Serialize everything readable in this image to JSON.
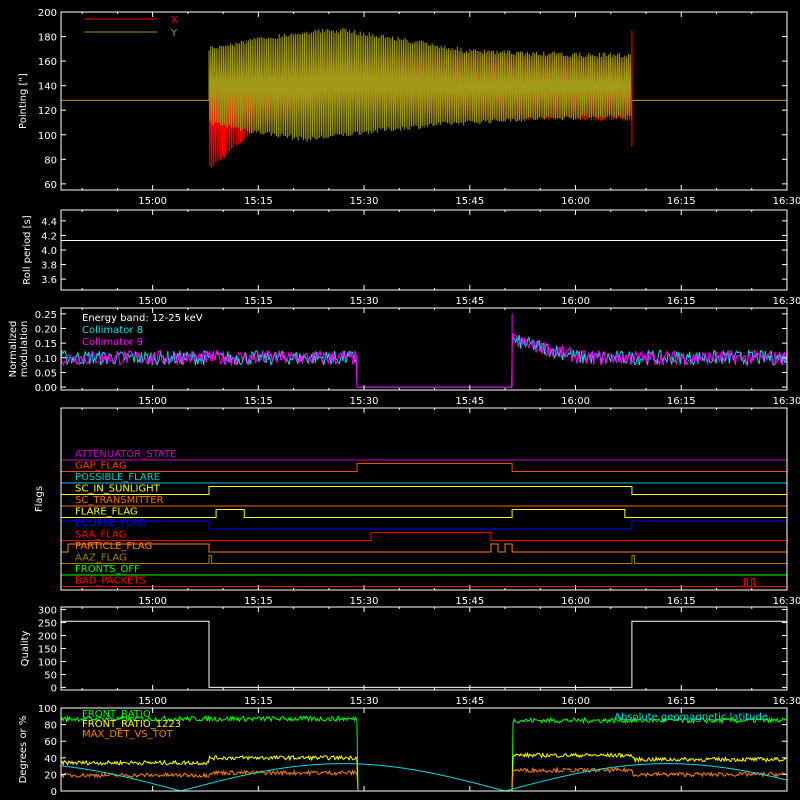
{
  "chart_data": [
    {
      "type": "line",
      "id": "pointing",
      "ylabel": "Pointing [\"]",
      "ylim": [
        55,
        200
      ],
      "yticks": [
        60,
        80,
        100,
        120,
        140,
        160,
        180,
        200
      ],
      "xlim": [
        "14:47",
        "16:30"
      ],
      "xticks": [
        "15:00",
        "15:15",
        "15:30",
        "15:45",
        "16:00",
        "16:15",
        "16:30"
      ],
      "legend": "top-left",
      "series": [
        {
          "name": "X",
          "color": "#ff0000",
          "baseline": 128,
          "active": [
            "15:08",
            "16:08"
          ],
          "upper_env": [
            [
              "15:08",
              165
            ],
            [
              "15:10",
              150
            ],
            [
              "15:20",
              162
            ],
            [
              "15:30",
              166
            ],
            [
              "15:40",
              168
            ],
            [
              "15:50",
              167
            ],
            [
              "16:00",
              164
            ],
            [
              "16:08",
              162
            ]
          ],
          "lower_env": [
            [
              "15:08",
              70
            ],
            [
              "15:10",
              80
            ],
            [
              "15:15",
              105
            ],
            [
              "15:25",
              122
            ],
            [
              "15:35",
              116
            ],
            [
              "15:45",
              112
            ],
            [
              "16:00",
              112
            ],
            [
              "16:08",
              110
            ]
          ]
        },
        {
          "name": "Y",
          "color": "#a09a18",
          "baseline": 128,
          "active": [
            "15:08",
            "16:08"
          ],
          "upper_env": [
            [
              "15:08",
              172
            ],
            [
              "15:15",
              180
            ],
            [
              "15:22",
              186
            ],
            [
              "15:27",
              187
            ],
            [
              "15:35",
              180
            ],
            [
              "15:45",
              170
            ],
            [
              "16:00",
              167
            ],
            [
              "16:08",
              167
            ]
          ],
          "lower_env": [
            [
              "15:08",
              108
            ],
            [
              "15:15",
              100
            ],
            [
              "15:22",
              94
            ],
            [
              "15:30",
              100
            ],
            [
              "15:40",
              106
            ],
            [
              "15:50",
              110
            ],
            [
              "16:00",
              112
            ],
            [
              "16:08",
              113
            ]
          ]
        }
      ]
    },
    {
      "type": "line",
      "id": "roll",
      "ylabel": "Roll period [s]",
      "ylim": [
        3.45,
        4.55
      ],
      "yticks": [
        3.6,
        3.8,
        4.0,
        4.2,
        4.4
      ],
      "xticks": [
        "15:00",
        "15:15",
        "15:30",
        "15:45",
        "16:00",
        "16:15",
        "16:30"
      ],
      "series": [
        {
          "name": "",
          "color": "#ffffff",
          "points": [
            [
              "14:47",
              4.13
            ],
            [
              "16:30",
              4.13
            ]
          ]
        }
      ]
    },
    {
      "type": "line",
      "id": "modulation",
      "ylabel": "Normalized modulation",
      "ylim": [
        -0.01,
        0.27
      ],
      "yticks": [
        0.0,
        0.05,
        0.1,
        0.15,
        0.2,
        0.25
      ],
      "ytick_labels": [
        "0.00",
        "0.05",
        "0.10",
        "0.15",
        "0.20",
        "0.25"
      ],
      "xticks": [
        "15:00",
        "15:15",
        "15:30",
        "15:45",
        "16:00",
        "16:15",
        "16:30"
      ],
      "annotation": "Energy band: 12-25 keV",
      "series": [
        {
          "name": "Collimator 8",
          "color": "#00e0e0"
        },
        {
          "name": "Collimator 9",
          "color": "#ff00ff"
        }
      ],
      "segments": [
        {
          "from": "14:47",
          "to": "15:29",
          "level": 0.1
        },
        {
          "from": "15:29",
          "to": "15:51",
          "level": 0.0
        },
        {
          "from": "15:51",
          "to": "16:30",
          "level": 0.12
        }
      ]
    },
    {
      "type": "table",
      "id": "flags",
      "ylabel": "Flags",
      "xticks": [
        "15:00",
        "15:15",
        "15:30",
        "15:45",
        "16:00",
        "16:15",
        "16:30"
      ],
      "rows": [
        {
          "name": "ATTENUATOR_STATE",
          "color": "#cc00cc",
          "on": []
        },
        {
          "name": "GAP_FLAG",
          "color": "#ff4400",
          "on": [
            [
              "15:29",
              "15:51"
            ]
          ]
        },
        {
          "name": "POSSIBLE_FLARE",
          "color": "#00c8c8",
          "on": []
        },
        {
          "name": "SC_IN_SUNLIGHT",
          "color": "#ffff00",
          "on": [
            [
              "15:08",
              "16:08"
            ]
          ]
        },
        {
          "name": "SC_TRANSMITTER",
          "color": "#ff6a00",
          "on": []
        },
        {
          "name": "FLARE_FLAG",
          "color": "#ffff00",
          "on": [
            [
              "15:09",
              "15:13"
            ],
            [
              "15:51",
              "16:07"
            ]
          ]
        },
        {
          "name": "ECLIPSE_FLAG",
          "color": "#0000ff",
          "on": [
            [
              "14:47",
              "15:08"
            ],
            [
              "16:08",
              "16:30"
            ]
          ]
        },
        {
          "name": "SAA_FLAG",
          "color": "#ff0000",
          "on": [
            [
              "15:31",
              "15:48"
            ]
          ]
        },
        {
          "name": "PARTICLE_FLAG",
          "color": "#ff8000",
          "on": [
            [
              "14:48",
              "15:08"
            ],
            [
              "15:48",
              "15:49"
            ],
            [
              "15:50",
              "15:51"
            ]
          ]
        },
        {
          "name": "AAZ_FLAG",
          "color": "#a08000",
          "on": [
            [
              "15:08",
              "15:08"
            ],
            [
              "16:08",
              "16:08"
            ]
          ]
        },
        {
          "name": "FRONTS_OFF",
          "color": "#00ff00",
          "on": []
        },
        {
          "name": "BAD_PACKETS",
          "color": "#ff0000",
          "on": [
            [
              "16:24",
              "16:24"
            ],
            [
              "16:25",
              "16:25"
            ]
          ]
        }
      ]
    },
    {
      "type": "line",
      "id": "quality",
      "ylabel": "Quality",
      "ylim": [
        -10,
        310
      ],
      "yticks": [
        0,
        50,
        100,
        150,
        200,
        250,
        300
      ],
      "xticks": [
        "15:00",
        "15:15",
        "15:30",
        "15:45",
        "16:00",
        "16:15",
        "16:30"
      ],
      "series": [
        {
          "name": "",
          "color": "#ffffff",
          "points": [
            [
              "14:47",
              255
            ],
            [
              "15:08",
              255
            ],
            [
              "15:08",
              0
            ],
            [
              "16:08",
              0
            ],
            [
              "16:08",
              255
            ],
            [
              "16:30",
              255
            ]
          ]
        }
      ]
    },
    {
      "type": "line",
      "id": "ratios",
      "ylabel": "Degrees or %",
      "ylim": [
        0,
        100
      ],
      "yticks": [
        0,
        20,
        40,
        60,
        80,
        100
      ],
      "series": [
        {
          "name": "FRONT_RATIO",
          "color": "#00ff00",
          "level_a": 87,
          "level_b": 85
        },
        {
          "name": "FRONT_RATIO_1223",
          "color": "#ffff00",
          "level_a": 40,
          "level_b": 43
        },
        {
          "name": "MAX_DET_VS_TOT",
          "color": "#ff8000",
          "level_a": 22,
          "level_b": 25
        },
        {
          "name": "Absolute geomagnetic latitude",
          "color": "#00e0e0"
        }
      ]
    }
  ]
}
